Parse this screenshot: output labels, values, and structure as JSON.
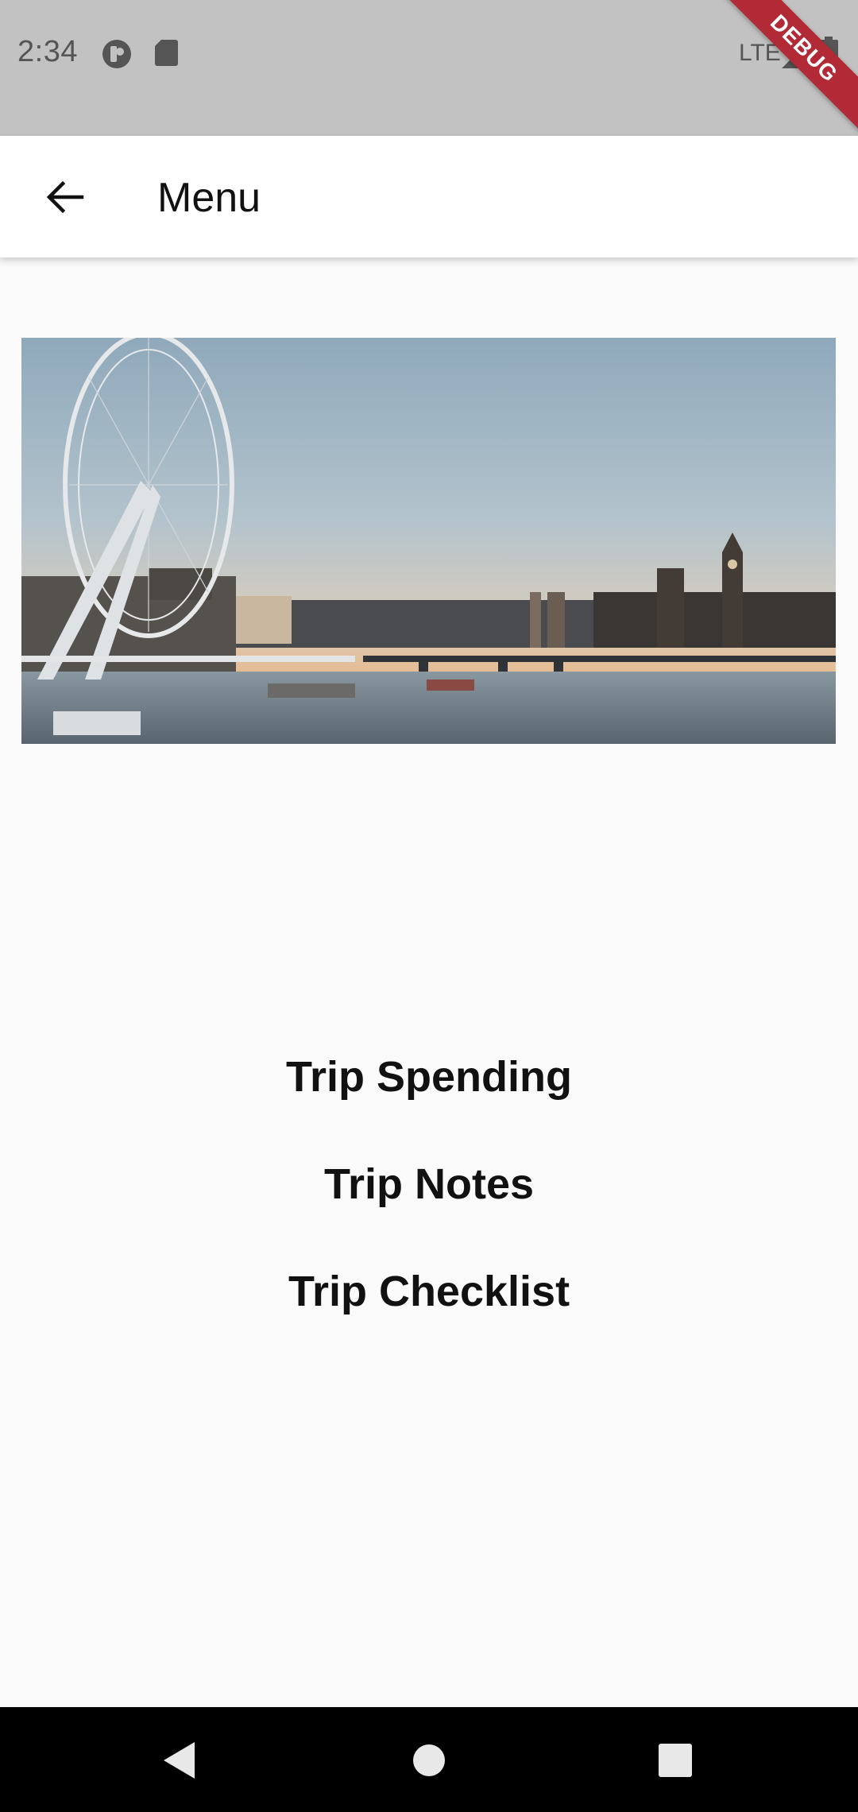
{
  "status_bar": {
    "time": "2:34",
    "network": "LTE",
    "debug_label": "DEBUG",
    "bg_color": "#c2c2c2"
  },
  "app_bar": {
    "title": "Menu",
    "back_icon": "arrow-back-icon"
  },
  "hero_image": {
    "description_icon": "london-skyline-photo"
  },
  "menu": {
    "items": [
      {
        "label": "Trip Spending"
      },
      {
        "label": "Trip Notes"
      },
      {
        "label": "Trip Checklist"
      }
    ]
  },
  "nav_bar": {
    "back_icon": "nav-back-icon",
    "home_icon": "nav-home-icon",
    "recents_icon": "nav-recents-icon"
  }
}
